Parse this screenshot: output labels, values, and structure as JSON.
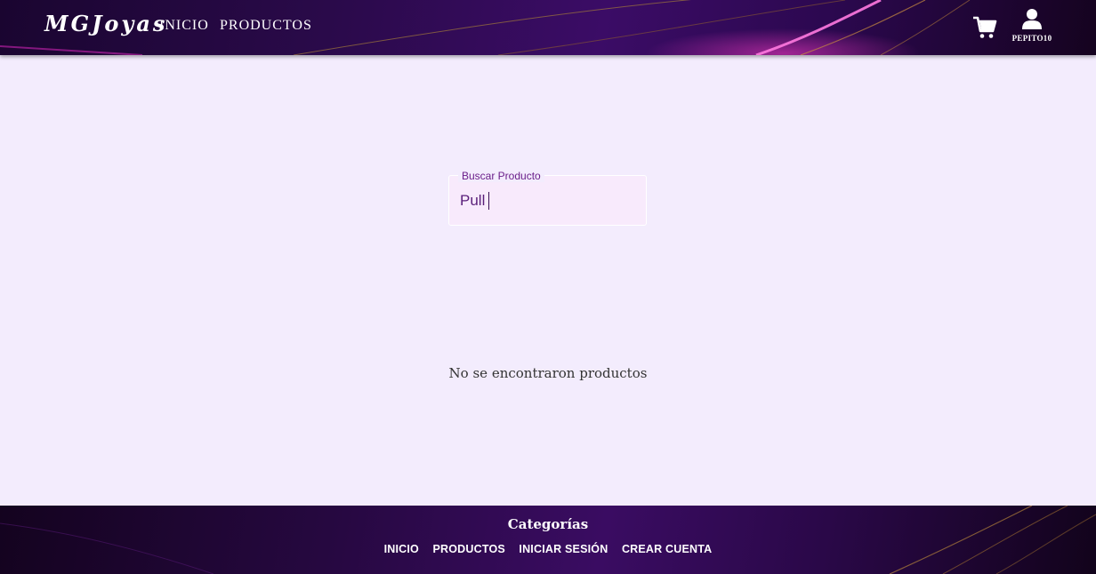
{
  "header": {
    "logo": "MGJoyas",
    "nav": [
      {
        "label": "INICIO"
      },
      {
        "label": "PRODUCTOS"
      }
    ],
    "cart_icon": "shopping-cart-icon",
    "user_icon": "user-icon",
    "username": "PEPITO10"
  },
  "search": {
    "label": "Buscar Producto",
    "value": "Pull"
  },
  "results": {
    "empty_message": "No se encontraron productos"
  },
  "footer": {
    "title": "Categorías",
    "links": [
      "INICIO",
      "PRODUCTOS",
      "INICIAR SESIÓN",
      "CREAR CUENTA"
    ]
  },
  "colors": {
    "background": "#f3ecfd",
    "header_bg": "#2a0a4a",
    "accent": "#6b1f8a",
    "highlight": "#ff3cc8"
  }
}
